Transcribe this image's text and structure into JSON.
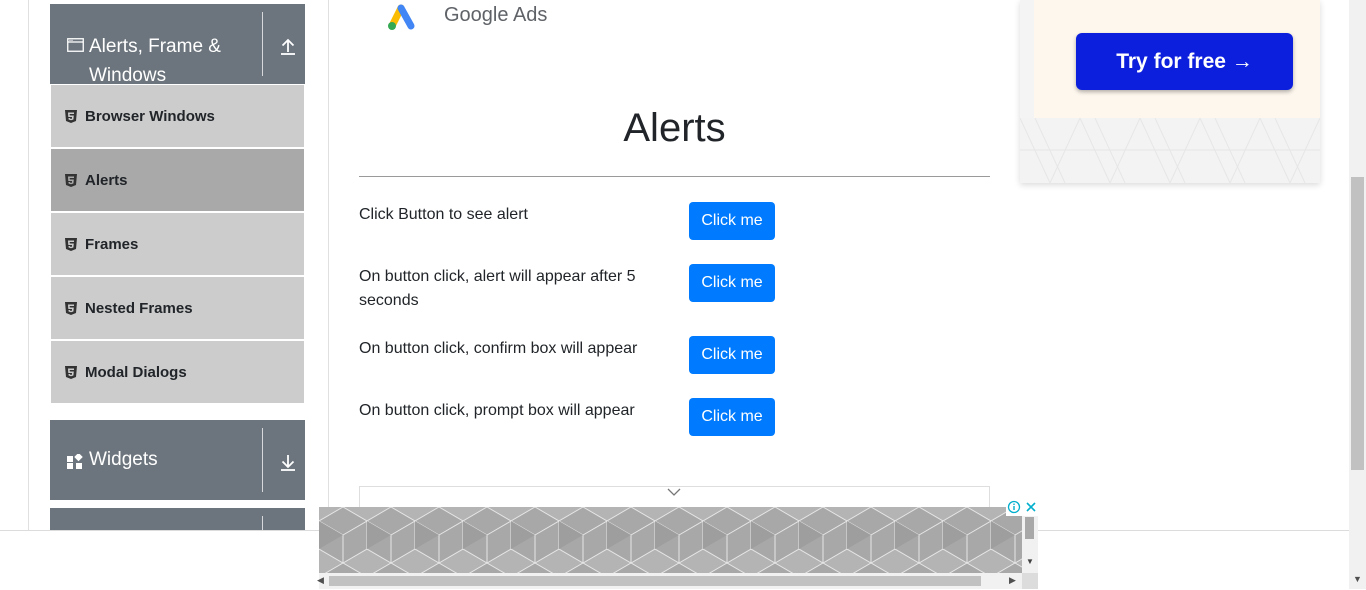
{
  "sidebar": {
    "group_alerts": {
      "label": "Alerts, Frame & Windows",
      "line1": "Alerts, Frame &",
      "line2": "Windows"
    },
    "items": [
      {
        "label": "Browser Windows",
        "active": false
      },
      {
        "label": "Alerts",
        "active": true
      },
      {
        "label": "Frames",
        "active": false
      },
      {
        "label": "Nested Frames",
        "active": false
      },
      {
        "label": "Modal Dialogs",
        "active": false
      }
    ],
    "group_widgets": {
      "label": "Widgets"
    }
  },
  "top_ad": {
    "brand": "Google Ads"
  },
  "main": {
    "title": "Alerts",
    "rows": [
      {
        "label": "Click Button to see alert",
        "button": "Click me"
      },
      {
        "label": "On button click, alert will appear after 5 seconds",
        "button": "Click me"
      },
      {
        "label": "On button click, confirm box will appear",
        "button": "Click me"
      },
      {
        "label": "On button click, prompt box will appear",
        "button": "Click me"
      }
    ]
  },
  "right_ad": {
    "cta": "Try for free →"
  },
  "colors": {
    "accent": "#007bff",
    "sidebar_header": "#6c757d",
    "menu_item": "#cccccc",
    "menu_item_active": "#a9a9a9",
    "cta": "#0c1fdc"
  },
  "icons": {
    "group_alerts": "window-icon",
    "group_widgets": "widgets-icon",
    "expand_up": "arrow-up-icon",
    "expand_down": "arrow-down-icon",
    "menu_item": "html5-icon",
    "ad_info": "info-icon",
    "ad_close": "close-icon",
    "ad_collapse": "chevron-down-icon"
  }
}
